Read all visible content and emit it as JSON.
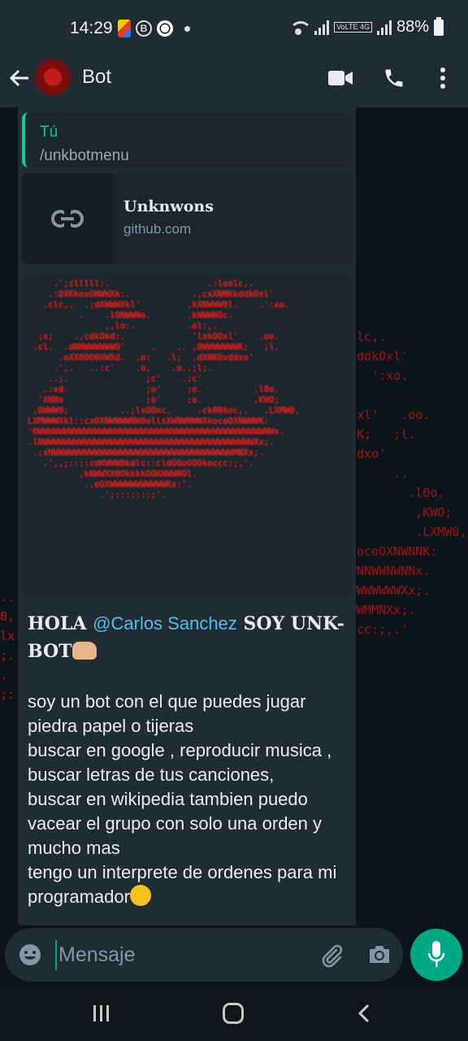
{
  "status_bar": {
    "time": "14:29",
    "battery": "88%",
    "network_badge": "VoLTE 4G"
  },
  "header": {
    "title": "Bot"
  },
  "quoted_message": {
    "author": "Tú",
    "text": "/unkbotmenu"
  },
  "link_preview": {
    "title": "Unknwons",
    "domain": "github.com"
  },
  "message": {
    "greeting_prefix": "HOLA ",
    "mention": "@Carlos Sanchez",
    "greeting_suffix": " SOY UNK-BOT",
    "lines": [
      "soy un bot  con el que puedes jugar piedra papel o tijeras",
      "buscar en google , reproducir musica , buscar letras de tus canciones,",
      "buscar en wikipedia tambien puedo vacear el grupo con solo una orden y mucho mas",
      "tengo un interprete de ordenes para mi programador"
    ]
  },
  "composer": {
    "placeholder": "Mensaje"
  },
  "colors": {
    "accent": "#00a884",
    "mention": "#53bdeb",
    "ascii_red": "#d11a1a",
    "bubble": "#1f2c34",
    "background": "#0b141a"
  }
}
